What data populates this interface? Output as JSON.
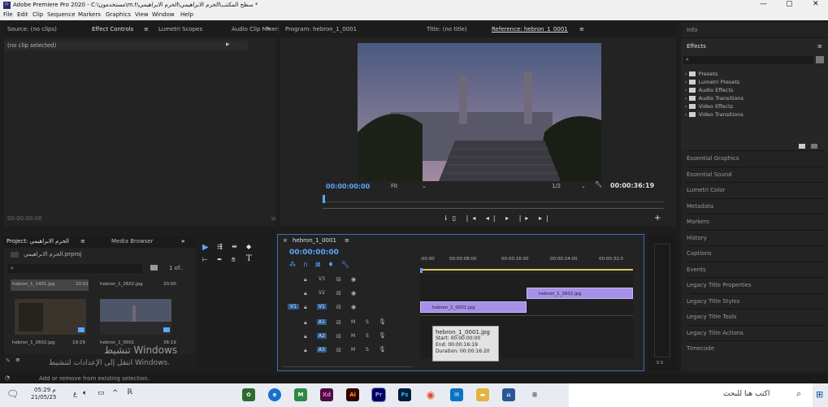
{
  "app": {
    "title": "Adobe Premiere Pro 2020 - C:\\مستخدمون\\m.t\\سطح المكتب\\الحرم الابراهيمي\\الحرم الابراهيمي *"
  },
  "menu": [
    "File",
    "Edit",
    "Clip",
    "Sequence",
    "Markers",
    "Graphics",
    "View",
    "Window",
    "Help"
  ],
  "source_panel": {
    "tabs": [
      "Source: (no clips)",
      "Effect Controls",
      "Lumetri Scopes",
      "Audio Clip Mixer: h"
    ],
    "empty_text": "(no clip selected)",
    "timecode": "00:00:00:00"
  },
  "program": {
    "tabs": [
      "Program: hebron_1_0001",
      "Title: (no title)",
      "Reference: hebron_1_0001"
    ],
    "timecode": "00:00:00:00",
    "fit": "Fit",
    "resolution": "1/2",
    "duration": "00:00:36:19"
  },
  "project": {
    "tabs": [
      "Project: الحرم الابراهيمي",
      "Media Browser"
    ],
    "file": "الحرم الابراهيمي.prproj",
    "count": "1 of..",
    "items": [
      {
        "name": "hebron_1_1401.jpg",
        "duration": "20:01"
      },
      {
        "name": "hebron_1_2602.jpg",
        "duration": "20:00"
      },
      {
        "name": "hebron_1_2602.jpg",
        "duration": "19:29"
      },
      {
        "name": "hebron_1_0001",
        "duration": "36:19"
      }
    ]
  },
  "timeline": {
    "tab": "hebron_1_0001",
    "timecode": "00:00:00:00",
    "ruler": [
      ":00:00",
      "00:00:08:00",
      "00:00:16:00",
      "00:00:24:00",
      "00:00:32:0"
    ],
    "video_tracks": [
      "V3",
      "V2",
      "V1"
    ],
    "audio_tracks": [
      "A1",
      "A2",
      "A3"
    ],
    "source_patch": "V1",
    "track_btns": {
      "m": "M",
      "s": "S"
    },
    "meter_label": "S S",
    "clips": [
      {
        "label": "hebron_1_2602.jpg",
        "start_s": 16.65,
        "end_s": 33.3,
        "track": "V2"
      },
      {
        "label": "hebron_1_0001.jpg",
        "start_s": 0,
        "end_s": 16.65,
        "track": "V1"
      }
    ],
    "tooltip": [
      "hebron_1_0001.jpg",
      "Start: 00:00:00:00",
      "End: 00:00:16:19",
      "Duration: 00:00:16:20"
    ]
  },
  "effects": {
    "title": "Effects",
    "tabs_top": "Info",
    "items": [
      "Presets",
      "Lumetri Presets",
      "Audio Effects",
      "Audio Transitions",
      "Video Effects",
      "Video Transitions"
    ]
  },
  "right_panels": [
    "Essential Graphics",
    "Essential Sound",
    "Lumetri Color",
    "Metadata",
    "Markers",
    "History",
    "Captions",
    "Events",
    "Legacy Title Properties",
    "Legacy Title Styles",
    "Legacy Title Tools",
    "Legacy Title Actions",
    "Timecode"
  ],
  "status": "Add or remove from existing selection.",
  "watermark": {
    "line1": "تنشيط Windows",
    "line2": "انتقل إلى الإعدادات لتنشيط Windows."
  },
  "taskbar": {
    "time": "05:29 م",
    "date": "21/05/25",
    "lang": "ع",
    "search": "اكتب هنا للبحث",
    "apps": [
      "Xd",
      "Ai",
      "Pr",
      "Ps"
    ]
  }
}
